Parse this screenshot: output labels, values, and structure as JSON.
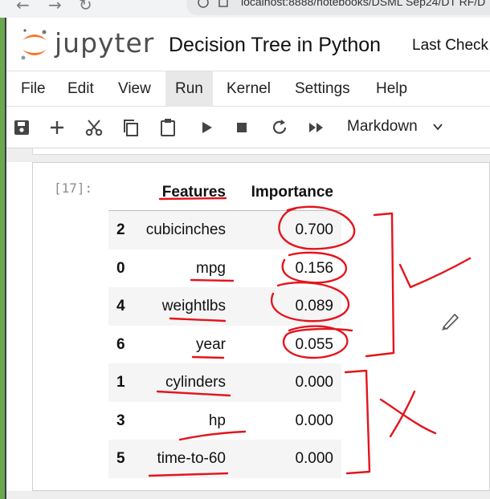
{
  "browser": {
    "url": "localhost:8888/notebooks/DSML Sep24/DT RF/D"
  },
  "header": {
    "logo_text": "jupyter",
    "notebook_title": "Decision Tree in Python",
    "checkpoint_text": "Last Check"
  },
  "menu": [
    "File",
    "Edit",
    "View",
    "Run",
    "Kernel",
    "Settings",
    "Help"
  ],
  "menu_active": "Run",
  "toolbar": {
    "cell_type": "Markdown",
    "icons": [
      "save-icon",
      "add-icon",
      "cut-icon",
      "copy-icon",
      "paste-icon",
      "run-icon",
      "stop-icon",
      "restart-icon",
      "fast-forward-icon"
    ]
  },
  "cell": {
    "prompt": "[17]:",
    "columns": [
      "Features",
      "Importance"
    ],
    "rows": [
      {
        "index": "2",
        "feature": "cubicinches",
        "importance": "0.700"
      },
      {
        "index": "0",
        "feature": "mpg",
        "importance": "0.156"
      },
      {
        "index": "4",
        "feature": "weightlbs",
        "importance": "0.089"
      },
      {
        "index": "6",
        "feature": "year",
        "importance": "0.055"
      },
      {
        "index": "1",
        "feature": "cylinders",
        "importance": "0.000"
      },
      {
        "index": "3",
        "feature": "hp",
        "importance": "0.000"
      },
      {
        "index": "5",
        "feature": "time-to-60",
        "importance": "0.000"
      }
    ]
  },
  "annotation_color": "#e4141c"
}
